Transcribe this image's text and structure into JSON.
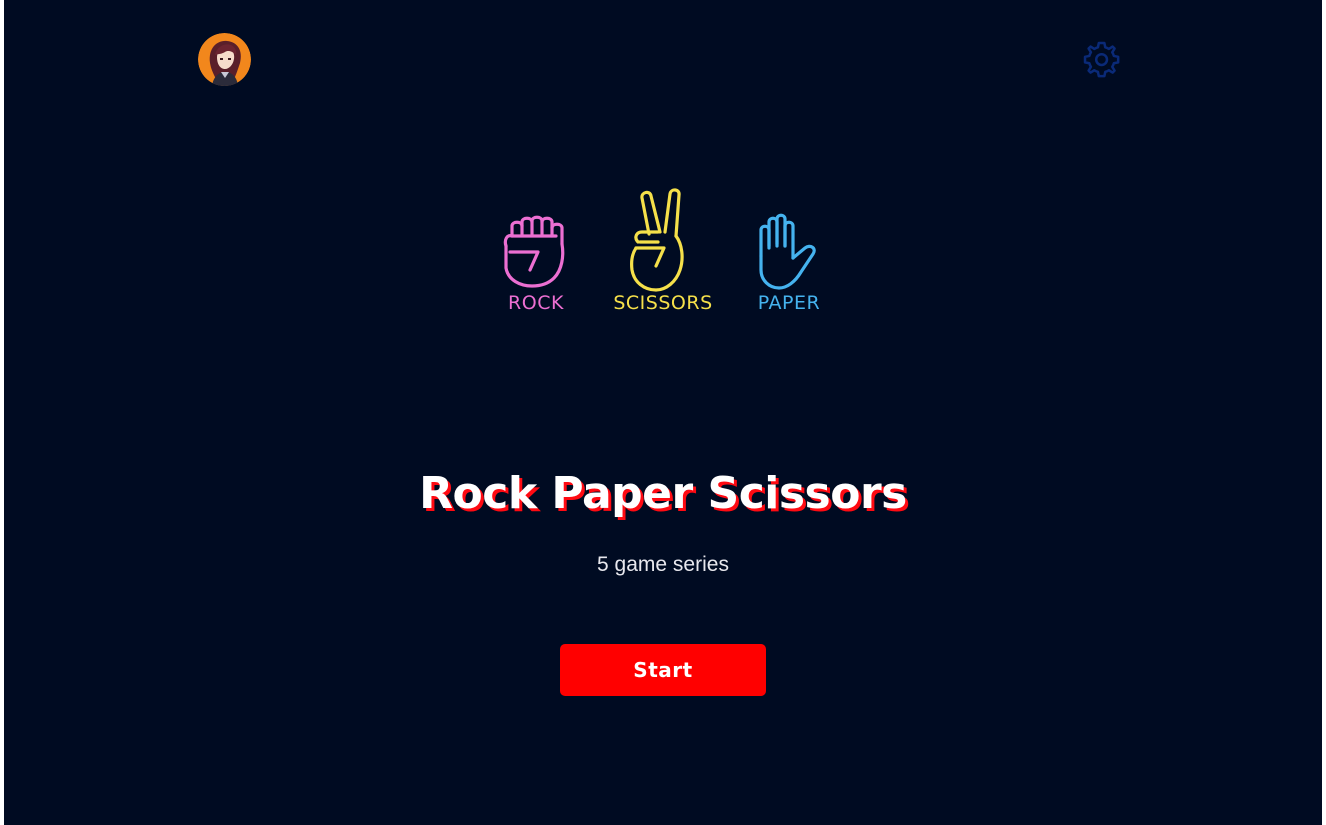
{
  "header": {
    "avatar_icon": "user-avatar",
    "settings_icon": "gear-icon",
    "settings_color": "#0a2a78"
  },
  "choices": [
    {
      "label": "ROCK",
      "icon": "fist-icon",
      "color": "#ec6fd2"
    },
    {
      "label": "SCISSORS",
      "icon": "peace-hand-icon",
      "color": "#f5e04a"
    },
    {
      "label": "PAPER",
      "icon": "open-hand-icon",
      "color": "#45b3ef"
    }
  ],
  "title": "Rock Paper Scissors",
  "subtitle": "5 game series",
  "start_label": "Start",
  "colors": {
    "background": "#000b22",
    "accent": "#ff0000",
    "title_shadow": "#ff0a12"
  }
}
